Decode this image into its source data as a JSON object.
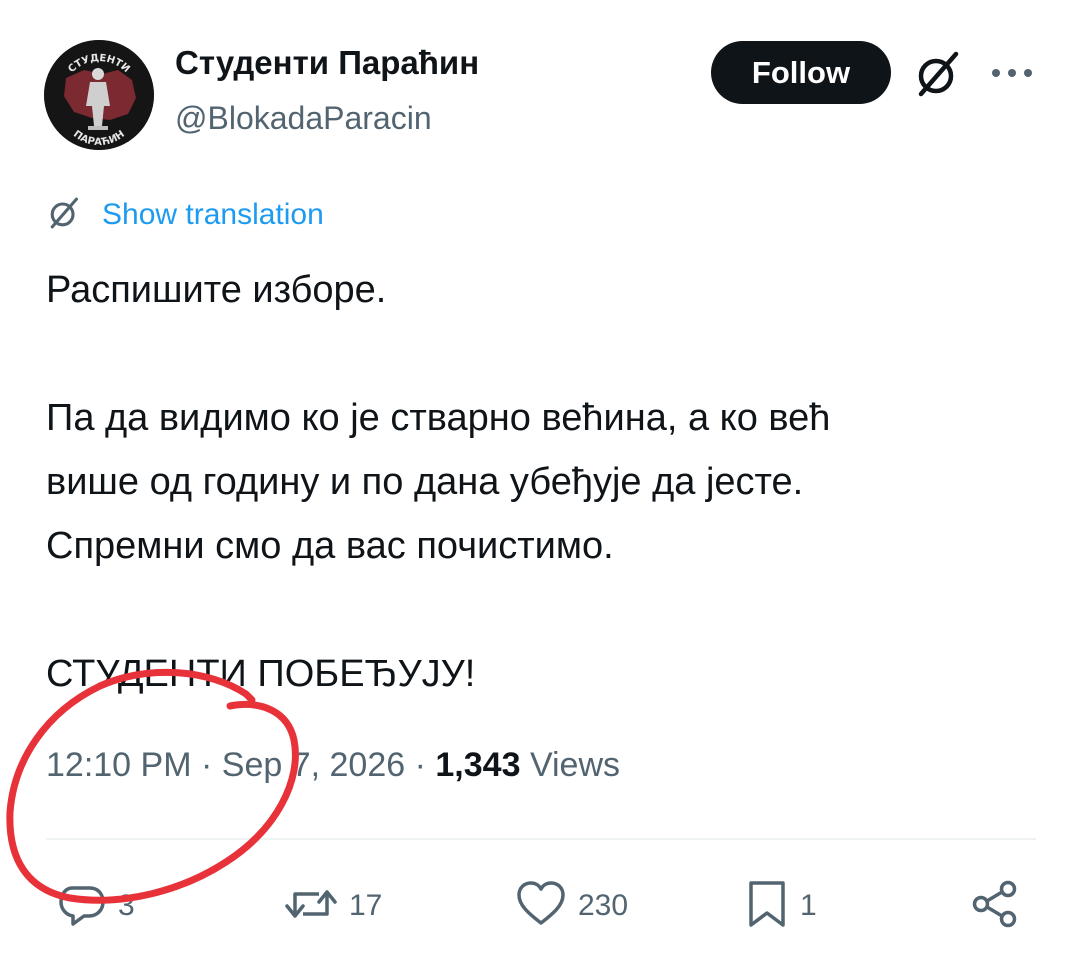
{
  "author": {
    "display_name": "Студенти Параћин",
    "handle": "@BlokadaParacin",
    "avatar_text_top": "СТУДЕНТИ",
    "avatar_text_bottom": "ПАРАЋИН"
  },
  "header": {
    "follow_label": "Follow",
    "more_label": "···"
  },
  "translation": {
    "label": "Show translation"
  },
  "tweet": {
    "paragraphs": [
      "Распишите изборе.",
      "",
      "Па да видимо ко је стварно већина, а ко већ",
      "више од годину и по дана убеђује да јесте.",
      "Спремни смо да вас почистимо.",
      "",
      "СТУДЕНТИ ПОБЕЂУЈУ!"
    ]
  },
  "meta": {
    "time": "12:10 PM",
    "date": "Sep 7, 2026",
    "separator": "·",
    "views_count": "1,343",
    "views_label": "Views"
  },
  "actions": {
    "replies": "3",
    "reposts": "17",
    "likes": "230",
    "bookmarks": "1"
  },
  "colors": {
    "accent": "#1d9bf0",
    "text": "#0f1419",
    "secondary": "#536471",
    "annotation": "#e8323a"
  }
}
